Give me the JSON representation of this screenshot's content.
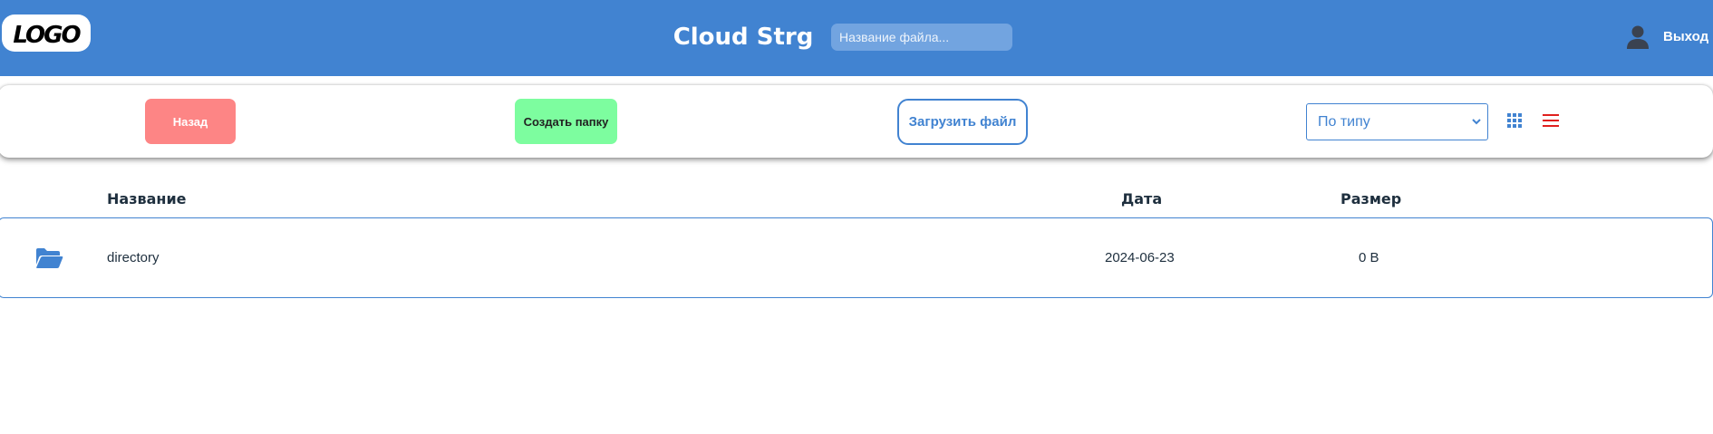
{
  "header": {
    "logo_text": "LOGO",
    "title": "Cloud Strg",
    "search": {
      "placeholder": "Название файла...",
      "value": ""
    },
    "user_icon": "user-icon",
    "logout_label": "Выход"
  },
  "toolbar": {
    "back_label": "Назад",
    "create_folder_label": "Создать папку",
    "upload_label": "Загрузить файл",
    "sort": {
      "selected": "По типу"
    },
    "view_icons": [
      "grid-view-icon",
      "list-view-icon"
    ]
  },
  "table": {
    "columns": {
      "name": "Название",
      "date": "Дата",
      "size": "Размер"
    },
    "rows": [
      {
        "icon": "folder-icon",
        "name": "directory",
        "date": "2024-06-23",
        "size": "0 B"
      }
    ]
  },
  "colors": {
    "header_bg": "#4183d1",
    "back_button": "#fd8585",
    "create_button": "#7dfd9f",
    "accent": "#4183d1",
    "list_icon": "#e0201e"
  }
}
